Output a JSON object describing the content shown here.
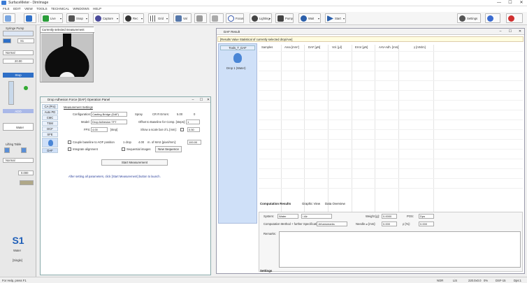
{
  "window": {
    "title": "SurfaceMeter - DimImage",
    "minimize": "—",
    "maximize": "☐",
    "close": "✕"
  },
  "menu": [
    "FILE",
    "EDIT",
    "VIEW",
    "TOOLS",
    "TECHNICAL",
    "WINDOWS",
    "HELP"
  ],
  "toolbar": [
    {
      "label": "Live",
      "icon": "camera-icon",
      "color": "#2a9d3a"
    },
    {
      "label": "Snap",
      "icon": "snapshot-icon",
      "color": "#555555"
    },
    {
      "label": "Capture",
      "icon": "lens-icon",
      "color": "#4a4a9a"
    },
    {
      "label": "Rec",
      "icon": "record-icon",
      "color": "#333333"
    },
    {
      "label": "Grid",
      "icon": "grid-icon",
      "color": "#555555"
    },
    {
      "label": "Val",
      "icon": "value-icon",
      "color": "#5577aa"
    },
    {
      "label": "Sine",
      "icon": "wave-icon",
      "color": "#777777"
    },
    {
      "label": "Smart Stage",
      "icon": "stage-icon",
      "color": "#888888"
    },
    {
      "label": "Focus",
      "icon": "target-icon",
      "color": "#3355aa"
    },
    {
      "label": "Lighting",
      "icon": "light-icon",
      "color": "#444444"
    },
    {
      "label": "Pump",
      "icon": "pump-icon",
      "color": "#444444"
    },
    {
      "label": "Wait",
      "icon": "wait-icon",
      "color": "#2b5faa"
    },
    {
      "label": "Start",
      "icon": "play-icon",
      "color": "#2b5faa"
    },
    {
      "label": "Settings",
      "icon": "gear-icon",
      "color": "#555555"
    },
    {
      "label": "Help",
      "icon": "help-icon",
      "color": "#3a6bd0"
    },
    {
      "label": "Exit",
      "icon": "power-icon",
      "color": "#d03030"
    }
  ],
  "leftpanel": {
    "syringe_title": "Syringe Pump",
    "syringe_value": "S1",
    "speed": "Normal",
    "volume": "20.00",
    "stop": "Stop",
    "add": "ADD",
    "liquid": "Water",
    "lifting_table": "Lifting Table",
    "lift_mode": "Normal",
    "lift_value": "0.000",
    "probe": "S1",
    "probe_liquid": "Water",
    "probe_status": "[Single]"
  },
  "image_panel": {
    "title": "Currently selected measurement"
  },
  "dialog": {
    "title": "Drop Adhesion Force (DAF) Operation Panel",
    "tabs": [
      "CA (Pro)",
      "Auto PD",
      "CMC",
      "TSM",
      "DCF",
      "SFE",
      "DAF"
    ],
    "active_tab": "DAF",
    "section": "Measurement Settings",
    "configuration_label": "Configuration:",
    "configuration_value": "Casting Bridge (DAF)",
    "model_label": "Model:",
    "model_value": "Drop Adhesion TFT",
    "fps_label": "FPS:",
    "fps_value": "4.00",
    "fps_unit": "[step]",
    "spray_label": "Spray",
    "cr_label": "CR R Errors:",
    "cr_value": "5.00",
    "cr_value2": "0",
    "baseline_label": "Offset to Baseline for Comp. [steps]:",
    "baseline_value": "1",
    "scale_label": "Show a scale bar of L [mm]:",
    "scale_value": "0.50",
    "couple_label": "Couple baseline to AOF position",
    "integrate_label": "Integrate alignment",
    "drops_label": "1 drop",
    "drops_value": "4.00",
    "ratio_label": "m. of MAS [pixel/mm]:",
    "ratio_value": "100.00",
    "sequential_label": "Sequential images",
    "new_sequence": "New Sequence",
    "start_button": "Start Measurement",
    "hint": "After setting all parameters, click [Start Measurement] button to launch."
  },
  "results": {
    "title": "DAF Result",
    "description": "[Results Value Statistical of currently selected drop/Ave]",
    "side_tab": "Tools_T_DAF",
    "side_item": "Drop 1 (Water)",
    "columns": [
      "Samples",
      "Area [mm²]",
      "DAF [µN]",
      "Vol. [µl]",
      "Error [µN]",
      "AAV-Adh. [mm]",
      "γ [mN/m]"
    ],
    "bottom_tabs": [
      "Computation Results",
      "Graphic View",
      "Data Overview"
    ],
    "settings_tab": "Settings",
    "setting_system_label": "System:",
    "setting_system_value": "Water",
    "setting_sep": "/ Air",
    "setting_weight_label": "Weight [g]:",
    "setting_weight_value": "0.0000",
    "setting_pos_label": "POS:",
    "setting_pos_value": "Dps",
    "setting_method_label": "Computation Method + further Specification:",
    "setting_method_value": "Jehansmarks",
    "setting_needle_label": "Needle ⌀ [mm]:",
    "setting_needle_value": "0.000",
    "setting_density_label": "ρ [%]:",
    "setting_density_value": "0.000",
    "setting_remarks_label": "Remarks:"
  },
  "status": {
    "left": "For Help, press F1",
    "s1": "NOR",
    "s2": "LiS",
    "s3": "220.0x0.0",
    "s4": "0%",
    "s5": "DSF-15",
    "s6": "Dps:1"
  },
  "colors": {
    "accent": "#2e6fc7",
    "panel_blue": "#cfe0f8",
    "desc_yellow": "#fffde0"
  }
}
